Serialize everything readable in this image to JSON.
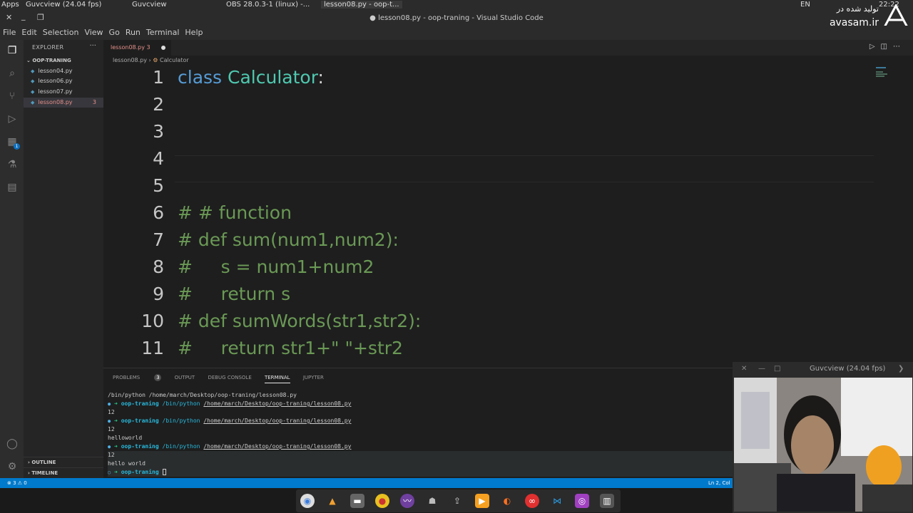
{
  "os_bar": {
    "apps": "Apps",
    "tab1": "Guvcview  (24.04 fps)",
    "tab2": "Guvcview",
    "tab3": "OBS 28.0.3-1 (linux) -...",
    "tab4": "lesson08.py - oop-t...",
    "lang": "EN",
    "time": "22:22"
  },
  "watermark": {
    "line1": "تولید شده در",
    "line2": "avasam.ir"
  },
  "window": {
    "title": "● lesson08.py - oop-traning - Visual Studio Code"
  },
  "menu": [
    "File",
    "Edit",
    "Selection",
    "View",
    "Go",
    "Run",
    "Terminal",
    "Help"
  ],
  "activity_badges": {
    "scm": "",
    "ext": "1"
  },
  "sidebar": {
    "header": "EXPLORER",
    "more": "···",
    "folder": "OOP-TRANING",
    "files": [
      {
        "name": "lesson04.py",
        "badge": ""
      },
      {
        "name": "lesson06.py",
        "badge": ""
      },
      {
        "name": "lesson07.py",
        "badge": ""
      },
      {
        "name": "lesson08.py",
        "badge": "3"
      }
    ],
    "outline": "OUTLINE",
    "timeline": "TIMELINE"
  },
  "editor": {
    "tab": {
      "label": "lesson08.py 3"
    },
    "breadcrumb": {
      "file": "lesson08.py",
      "symbol": "Calculator"
    },
    "lines": [
      {
        "n": "1"
      },
      {
        "n": "2"
      },
      {
        "n": "3"
      },
      {
        "n": "4"
      },
      {
        "n": "5"
      },
      {
        "n": "6",
        "text": "# # function"
      },
      {
        "n": "7",
        "text": "# def sum(num1,num2):"
      },
      {
        "n": "8",
        "text": "#     s = num1+num2"
      },
      {
        "n": "9",
        "text": "#     return s"
      },
      {
        "n": "10",
        "text": "# def sumWords(str1,str2):"
      },
      {
        "n": "11",
        "text": "#     return str1+\" \"+str2"
      }
    ],
    "line1": {
      "kw": "class",
      "name": "Calculator",
      "colon": ":"
    }
  },
  "panel": {
    "tabs": {
      "problems": "PROBLEMS",
      "problems_count": "3",
      "output": "OUTPUT",
      "debug": "DEBUG CONSOLE",
      "terminal": "TERMINAL",
      "jupyter": "JUPYTER"
    },
    "terminal": {
      "first": "/bin/python /home/march/Desktop/oop-traning/lesson08.py",
      "prompt_dir": "oop-traning",
      "cmd": "/bin/python",
      "path": "/home/march/Desktop/oop-traning/lesson08.py",
      "out1": "12",
      "out2": "12",
      "out3": "helloworld",
      "out4": "12",
      "out5": "hello world"
    }
  },
  "status": {
    "left": "⊗ 3 ⚠ 0",
    "right": "Ln 2, Col"
  },
  "webcam": {
    "title": "Guvcview  (24.04 fps)"
  },
  "colors": {
    "statusbar": "#007acc",
    "keyword": "#569cd6",
    "class": "#4ec9b0",
    "comment": "#6a9955"
  }
}
